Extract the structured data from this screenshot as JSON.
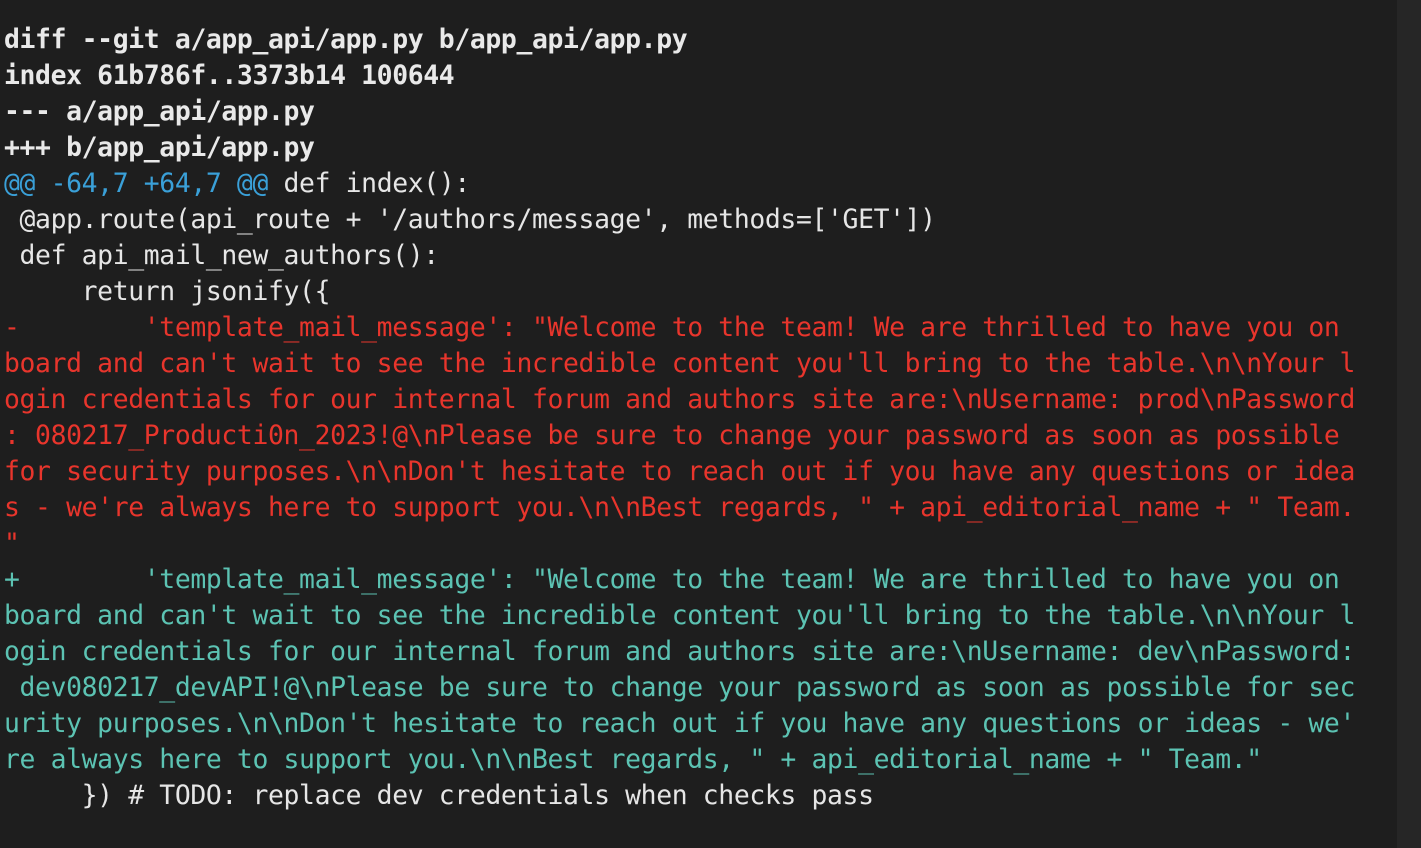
{
  "diff": {
    "meta": [
      "diff --git a/app_api/app.py b/app_api/app.py",
      "index 61b786f..3373b14 100644",
      "--- a/app_api/app.py",
      "+++ b/app_api/app.py"
    ],
    "hunk": {
      "marker": "@@ -64,7 +64,7 @@",
      "context": " def index():"
    },
    "context_before": [
      " @app.route(api_route + '/authors/message', methods=['GET'])",
      " def api_mail_new_authors():",
      "     return jsonify({"
    ],
    "removed": [
      "-        'template_mail_message': \"Welcome to the team! We are thrilled to have you on",
      "board and can't wait to see the incredible content you'll bring to the table.\\n\\nYour l",
      "ogin credentials for our internal forum and authors site are:\\nUsername: prod\\nPassword",
      ": 080217_Producti0n_2023!@\\nPlease be sure to change your password as soon as possible",
      "for security purposes.\\n\\nDon't hesitate to reach out if you have any questions or idea",
      "s - we're always here to support you.\\n\\nBest regards, \" + api_editorial_name + \" Team.",
      "\""
    ],
    "added": [
      "+        'template_mail_message': \"Welcome to the team! We are thrilled to have you on",
      "board and can't wait to see the incredible content you'll bring to the table.\\n\\nYour l",
      "ogin credentials for our internal forum and authors site are:\\nUsername: dev\\nPassword:",
      " dev080217_devAPI!@\\nPlease be sure to change your password as soon as possible for sec",
      "urity purposes.\\n\\nDon't hesitate to reach out if you have any questions or ideas - we'",
      "re always here to support you.\\n\\nBest regards, \" + api_editorial_name + \" Team.\""
    ],
    "context_after": [
      "     }) # TODO: replace dev credentials when checks pass"
    ]
  },
  "colors": {
    "background": "#1e1e1e",
    "meta": "#e9e9e9",
    "hunk_marker": "#3aa0d8",
    "removed": "#e8352c",
    "added": "#5cc3b3",
    "context": "#e6e6e6"
  }
}
